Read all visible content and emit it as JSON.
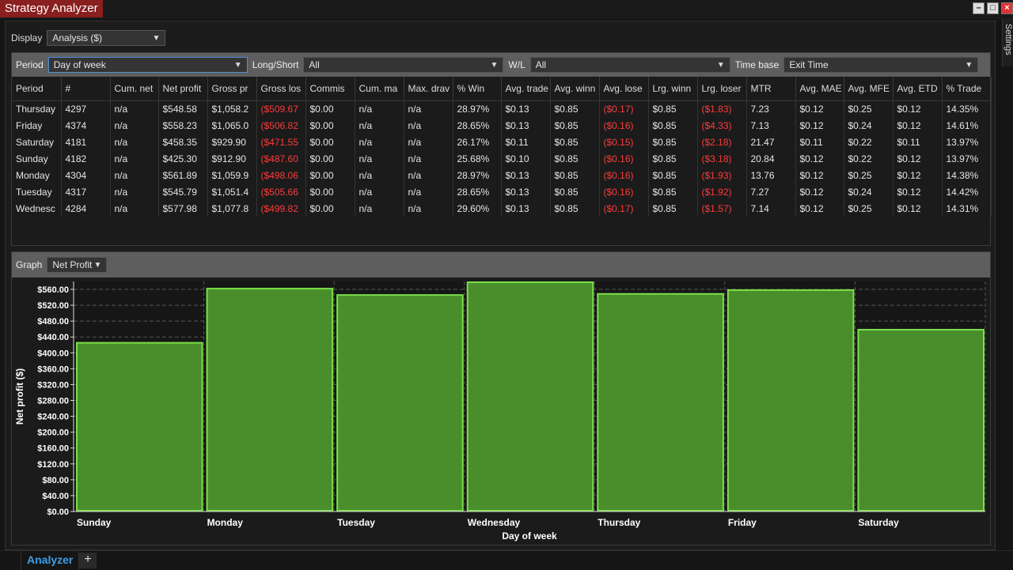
{
  "window": {
    "title": "Strategy Analyzer",
    "side_tab": "Settings"
  },
  "display": {
    "label": "Display",
    "value": "Analysis ($)"
  },
  "filters": {
    "period_label": "Period",
    "period_value": "Day of week",
    "longshort_label": "Long/Short",
    "longshort_value": "All",
    "wl_label": "W/L",
    "wl_value": "All",
    "timebase_label": "Time base",
    "timebase_value": "Exit Time"
  },
  "table": {
    "headers": [
      "Period",
      "#",
      "Cum. net",
      "Net profit",
      "Gross pr",
      "Gross los",
      "Commis",
      "Cum. ma",
      "Max. drav",
      "% Win",
      "Avg. trade",
      "Avg. winn",
      "Avg. lose",
      "Lrg. winn",
      "Lrg. loser",
      "MTR",
      "Avg. MAE",
      "Avg. MFE",
      "Avg. ETD",
      "% Trade"
    ],
    "rows": [
      [
        "Thursday",
        "4297",
        "n/a",
        "$548.58",
        "$1,058.2",
        "($509.67",
        "$0.00",
        "n/a",
        "n/a",
        "28.97%",
        "$0.13",
        "$0.85",
        "($0.17)",
        "$0.85",
        "($1.83)",
        "7.23",
        "$0.12",
        "$0.25",
        "$0.12",
        "14.35%"
      ],
      [
        "Friday",
        "4374",
        "n/a",
        "$558.23",
        "$1,065.0",
        "($506.82",
        "$0.00",
        "n/a",
        "n/a",
        "28.65%",
        "$0.13",
        "$0.85",
        "($0.16)",
        "$0.85",
        "($4.33)",
        "7.13",
        "$0.12",
        "$0.24",
        "$0.12",
        "14.61%"
      ],
      [
        "Saturday",
        "4181",
        "n/a",
        "$458.35",
        "$929.90",
        "($471.55",
        "$0.00",
        "n/a",
        "n/a",
        "26.17%",
        "$0.11",
        "$0.85",
        "($0.15)",
        "$0.85",
        "($2.18)",
        "21.47",
        "$0.11",
        "$0.22",
        "$0.11",
        "13.97%"
      ],
      [
        "Sunday",
        "4182",
        "n/a",
        "$425.30",
        "$912.90",
        "($487.60",
        "$0.00",
        "n/a",
        "n/a",
        "25.68%",
        "$0.10",
        "$0.85",
        "($0.16)",
        "$0.85",
        "($3.18)",
        "20.84",
        "$0.12",
        "$0.22",
        "$0.12",
        "13.97%"
      ],
      [
        "Monday",
        "4304",
        "n/a",
        "$561.89",
        "$1,059.9",
        "($498.06",
        "$0.00",
        "n/a",
        "n/a",
        "28.97%",
        "$0.13",
        "$0.85",
        "($0.16)",
        "$0.85",
        "($1.93)",
        "13.76",
        "$0.12",
        "$0.25",
        "$0.12",
        "14.38%"
      ],
      [
        "Tuesday",
        "4317",
        "n/a",
        "$545.79",
        "$1,051.4",
        "($505.66",
        "$0.00",
        "n/a",
        "n/a",
        "28.65%",
        "$0.13",
        "$0.85",
        "($0.16)",
        "$0.85",
        "($1.92)",
        "7.27",
        "$0.12",
        "$0.24",
        "$0.12",
        "14.42%"
      ],
      [
        "Wednesc",
        "4284",
        "n/a",
        "$577.98",
        "$1,077.8",
        "($499.82",
        "$0.00",
        "n/a",
        "n/a",
        "29.60%",
        "$0.13",
        "$0.85",
        "($0.17)",
        "$0.85",
        "($1.57)",
        "7.14",
        "$0.12",
        "$0.25",
        "$0.12",
        "14.31%"
      ]
    ]
  },
  "graph": {
    "label": "Graph",
    "value": "Net Profit"
  },
  "chart_data": {
    "type": "bar",
    "categories": [
      "Sunday",
      "Monday",
      "Tuesday",
      "Wednesday",
      "Thursday",
      "Friday",
      "Saturday"
    ],
    "values": [
      425.3,
      561.89,
      545.79,
      577.98,
      548.58,
      558.23,
      458.35
    ],
    "xlabel": "Day of week",
    "ylabel": "Net profit ($)",
    "ylim": [
      0,
      580
    ],
    "yticks": [
      "$0.00",
      "$40.00",
      "$80.00",
      "$120.00",
      "$160.00",
      "$200.00",
      "$240.00",
      "$280.00",
      "$320.00",
      "$360.00",
      "$400.00",
      "$440.00",
      "$480.00",
      "$520.00",
      "$560.00"
    ],
    "grid": true,
    "bar_fill": "#4a8e2c",
    "bar_border": "#7be04a"
  },
  "bottom": {
    "tab_label": "Analyzer",
    "add_label": "+"
  }
}
